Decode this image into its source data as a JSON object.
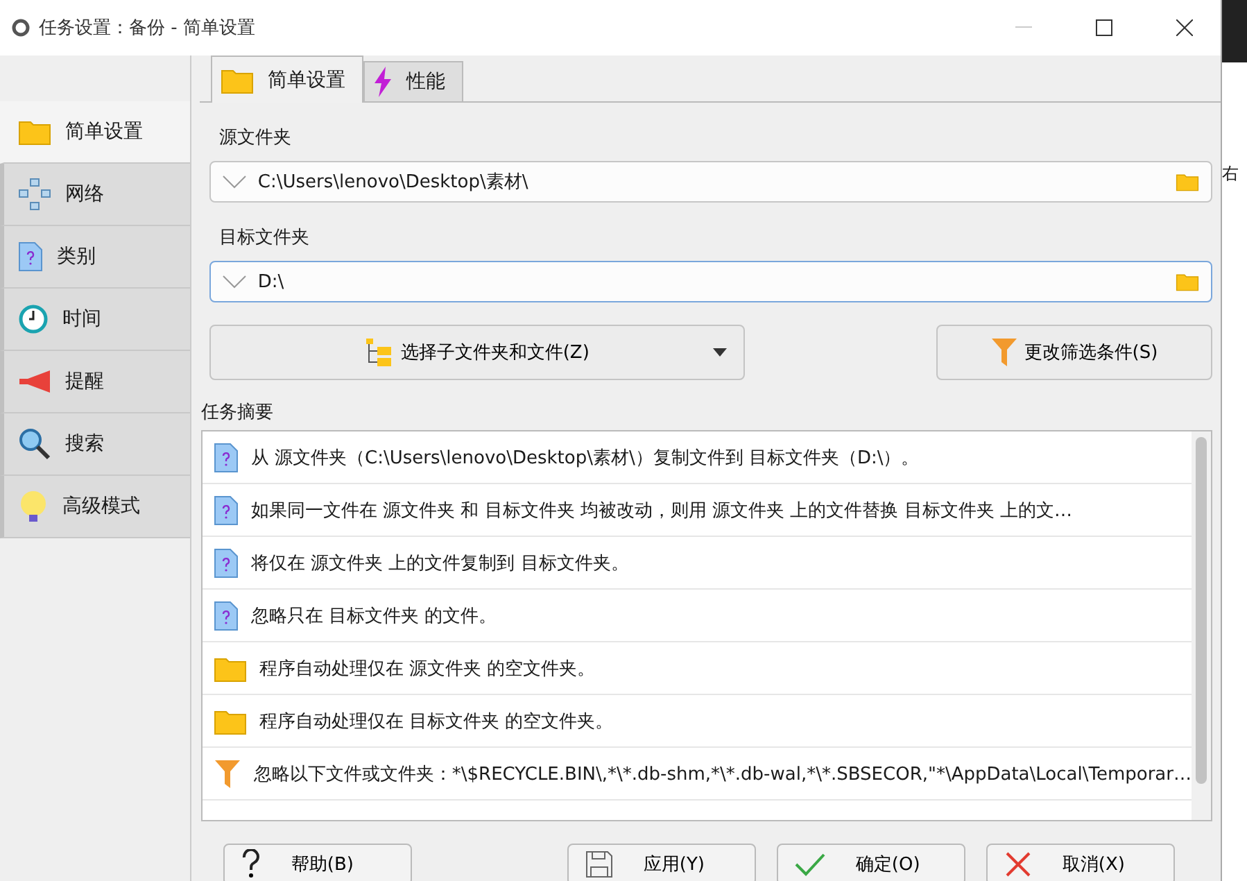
{
  "window": {
    "title": "任务设置：备份 - 简单设置"
  },
  "tabs": [
    {
      "label": "简单设置",
      "kind": "folder",
      "selected": true
    },
    {
      "label": "性能",
      "kind": "bolt",
      "selected": false
    }
  ],
  "sidebar": {
    "items": [
      {
        "label": "简单设置",
        "kind": "folder",
        "selected": true
      },
      {
        "label": "网络",
        "kind": "network",
        "selected": false
      },
      {
        "label": "类别",
        "kind": "file",
        "selected": false
      },
      {
        "label": "时间",
        "kind": "clock",
        "selected": false
      },
      {
        "label": "提醒",
        "kind": "megaphone",
        "selected": false
      },
      {
        "label": "搜索",
        "kind": "search",
        "selected": false
      },
      {
        "label": "高级模式",
        "kind": "bulb",
        "selected": false
      }
    ]
  },
  "source": {
    "label": "源文件夹",
    "value": "C:\\Users\\lenovo\\Desktop\\素材\\",
    "focused": false
  },
  "target": {
    "label": "目标文件夹",
    "value": "D:\\",
    "focused": true
  },
  "actions": [
    {
      "label": "选择子文件夹和文件(Z)",
      "kind": "tree",
      "dropdown": true
    },
    {
      "label": "更改筛选条件(S)",
      "kind": "filter",
      "dropdown": false
    }
  ],
  "summary": {
    "label": "任务摘要",
    "rows": [
      {
        "kind": "file",
        "text": "从 源文件夹（C:\\Users\\lenovo\\Desktop\\素材\\）复制文件到 目标文件夹（D:\\）。"
      },
      {
        "kind": "file",
        "text": "如果同一文件在 源文件夹 和 目标文件夹 均被改动，则用 源文件夹 上的文件替换 目标文件夹 上的文…"
      },
      {
        "kind": "file",
        "text": "将仅在 源文件夹 上的文件复制到 目标文件夹。"
      },
      {
        "kind": "file",
        "text": "忽略只在 目标文件夹 的文件。"
      },
      {
        "kind": "folder",
        "text": "程序自动处理仅在 源文件夹 的空文件夹。"
      },
      {
        "kind": "folder",
        "text": "程序自动处理仅在 目标文件夹 的空文件夹。"
      },
      {
        "kind": "filter",
        "text": "忽略以下文件或文件夹：*\\$RECYCLE.BIN\\,*\\*.db-shm,*\\*.db-wal,*\\*.SBSECOR,\"*\\AppData\\Local\\Temporar…"
      }
    ]
  },
  "buttons": [
    {
      "label": "帮助(B)",
      "kind": "help"
    },
    {
      "label": "应用(Y)",
      "kind": "save"
    },
    {
      "label": "确定(O)",
      "kind": "ok"
    },
    {
      "label": "取消(X)",
      "kind": "cancel"
    }
  ],
  "background_text": "右"
}
